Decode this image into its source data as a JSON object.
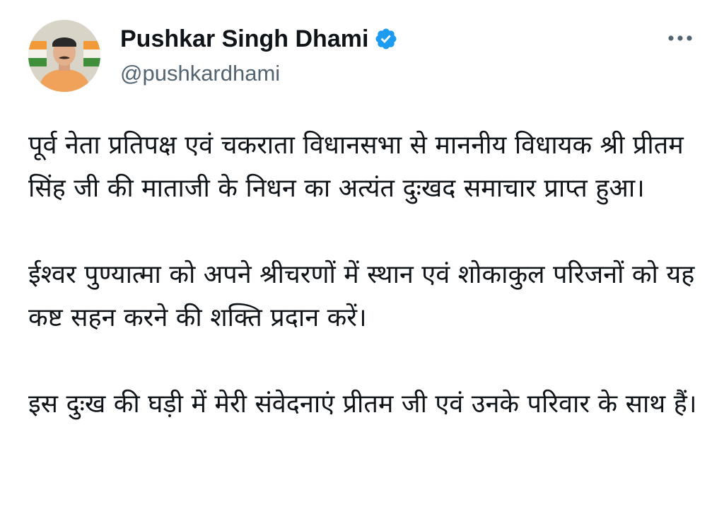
{
  "author": {
    "display_name": "Pushkar Singh Dhami",
    "handle": "@pushkardhami",
    "verified": true,
    "verified_color": "#1d9bf0",
    "avatar_icon": "profile-photo"
  },
  "more_icon": "more-horizontal-icon",
  "tweet": {
    "paragraphs": [
      "पूर्व नेता प्रतिपक्ष एवं चकराता विधानसभा से माननीय  विधायक श्री प्रीतम सिंह जी की माताजी के निधन का अत्यंत दुःखद समाचार प्राप्त हुआ।",
      "ईश्वर पुण्यात्मा को अपने श्रीचरणों में स्थान एवं शोकाकुल परिजनों को यह कष्ट सहन करने की शक्ति प्रदान करें।",
      "इस दुःख की घड़ी में मेरी संवेदनाएं प्रीतम जी एवं उनके परिवार के साथ हैं।"
    ]
  }
}
